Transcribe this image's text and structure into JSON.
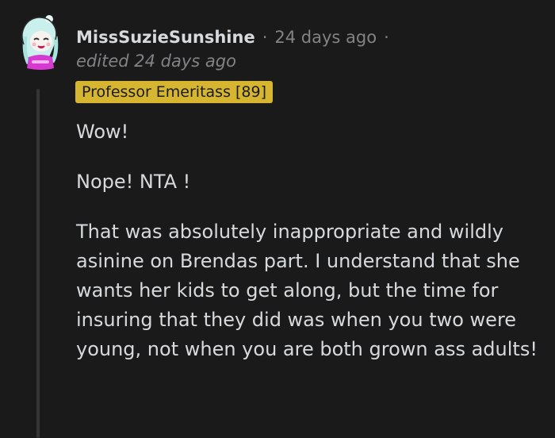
{
  "comment": {
    "author": "MissSuzieSunshine",
    "separator": "·",
    "timestamp": "24 days ago",
    "edited": "edited 24 days ago",
    "flair": "Professor Emeritass [89]",
    "paragraphs": [
      "Wow!",
      "Nope! NTA !",
      "That was absolutely inappropriate and wildly asinine on Brendas part. I understand that she wants her kids to get along, but the time for insuring that they did was when you two were young, not when you are both grown ass adults!"
    ]
  },
  "colors": {
    "background": "#1a1a1b",
    "text": "#d7dadc",
    "muted": "#818384",
    "flair_bg": "#d6b631",
    "thread_line": "#343536"
  }
}
